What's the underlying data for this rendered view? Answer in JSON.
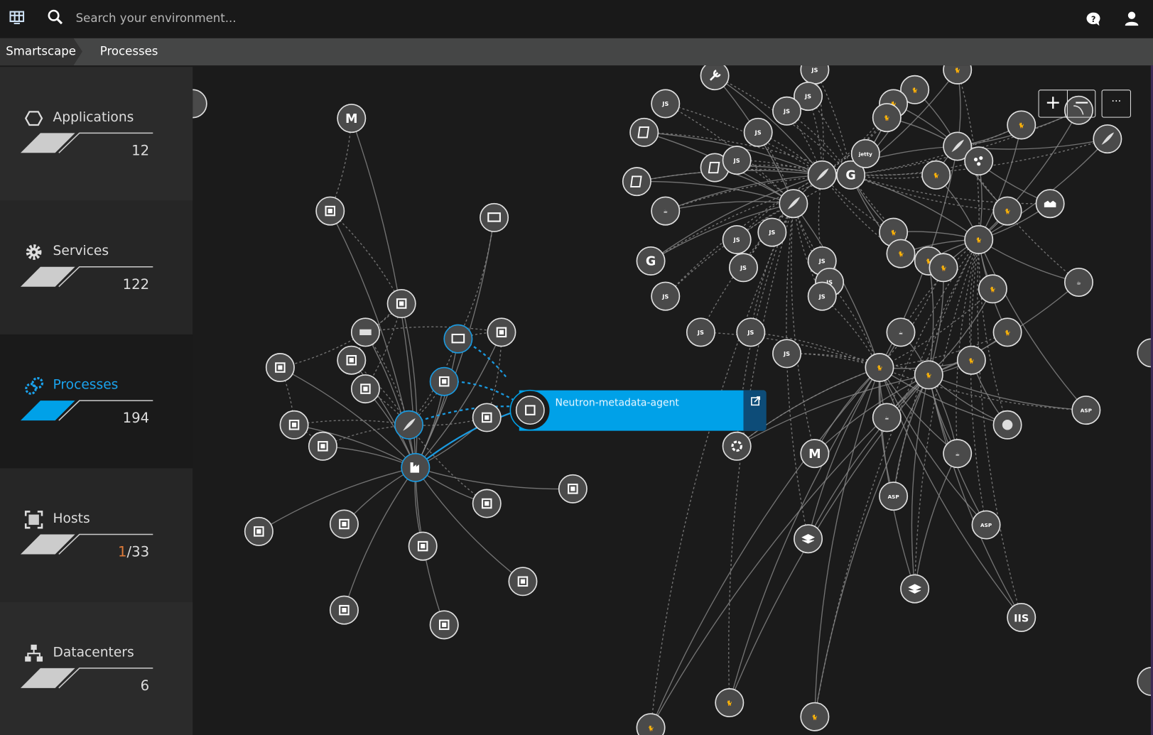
{
  "topbar": {
    "search_placeholder": "Search your environment...",
    "icons": [
      "dashboard-icon",
      "search-icon",
      "help-icon",
      "user-icon"
    ]
  },
  "breadcrumb": [
    "Smartscape",
    "Processes"
  ],
  "sidebar": {
    "items": [
      {
        "label": "Applications",
        "count": "12",
        "icon": "hexagon-icon"
      },
      {
        "label": "Services",
        "count": "122",
        "icon": "gear-icon"
      },
      {
        "label": "Processes",
        "count": "194",
        "icon": "processes-icon",
        "active": true
      },
      {
        "label": "Hosts",
        "count_highlight": "1",
        "count_rest": "/33",
        "icon": "host-icon"
      },
      {
        "label": "Datacenters",
        "count": "6",
        "icon": "datacenter-icon"
      }
    ]
  },
  "graph": {
    "tooltip": {
      "label": "Neutron-metadata-agent"
    },
    "controls": {
      "zoom_in": "+",
      "zoom_out": "−",
      "more": "···"
    }
  },
  "colors": {
    "accent": "#00a1e8",
    "active_bg": "#1a1a1a",
    "highlight_count": "#e07b39"
  }
}
